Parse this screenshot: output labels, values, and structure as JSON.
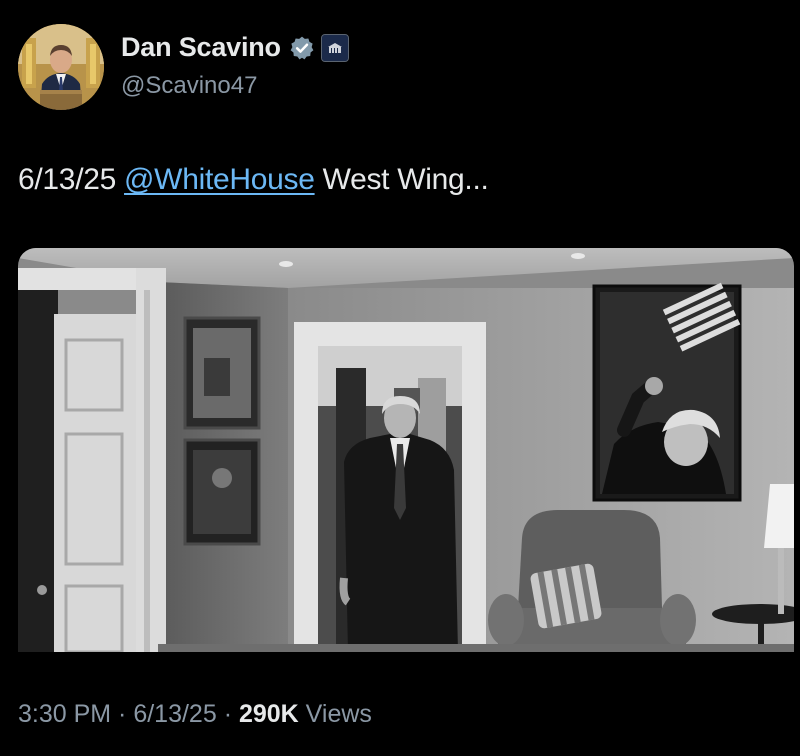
{
  "author": {
    "display_name": "Dan Scavino",
    "handle": "@Scavino47",
    "avatar_icon": "profile-photo",
    "verified_icon": "verified-badge-icon",
    "affiliation_badge_icon": "white-house-badge-icon",
    "affiliation_badge_text": "WHITE HOUSE"
  },
  "tweet": {
    "text_prefix": "6/13/25 ",
    "mention": "@WhiteHouse",
    "text_suffix": " West Wing...",
    "link_color": "#6cb8f5"
  },
  "media": {
    "description_icon": "photo-icon"
  },
  "meta": {
    "time": "3:30 PM",
    "separator_1": " · ",
    "date": "6/13/25",
    "separator_2": " · ",
    "views_count": "290K",
    "views_label": " Views"
  },
  "colors": {
    "background": "#000000",
    "primary_text": "#e7e9ea",
    "secondary_text": "#8b98a5",
    "verified_blue": "#829aab"
  }
}
